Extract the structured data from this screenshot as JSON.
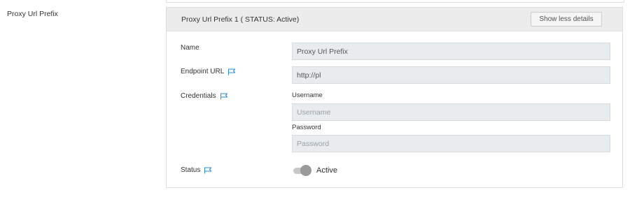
{
  "section": {
    "label": "Proxy Url Prefix"
  },
  "card": {
    "title": "Proxy Url Prefix 1 ( STATUS: Active)",
    "toggle_details_label": "Show less details"
  },
  "fields": {
    "name": {
      "label": "Name",
      "value": "Proxy Url Prefix"
    },
    "endpoint": {
      "label": "Endpoint URL",
      "value": "http://pl",
      "icon": "flag-icon"
    },
    "credentials": {
      "label": "Credentials",
      "icon": "flag-icon",
      "username_label": "Username",
      "username_placeholder": "Username",
      "password_label": "Password",
      "password_placeholder": "Password"
    },
    "status": {
      "label": "Status",
      "icon": "flag-icon",
      "toggle_label": "Active",
      "enabled": true
    }
  },
  "colors": {
    "header_bg": "#ececec",
    "input_bg": "#e8ecef",
    "flag_icon": "#2b8fd6"
  }
}
